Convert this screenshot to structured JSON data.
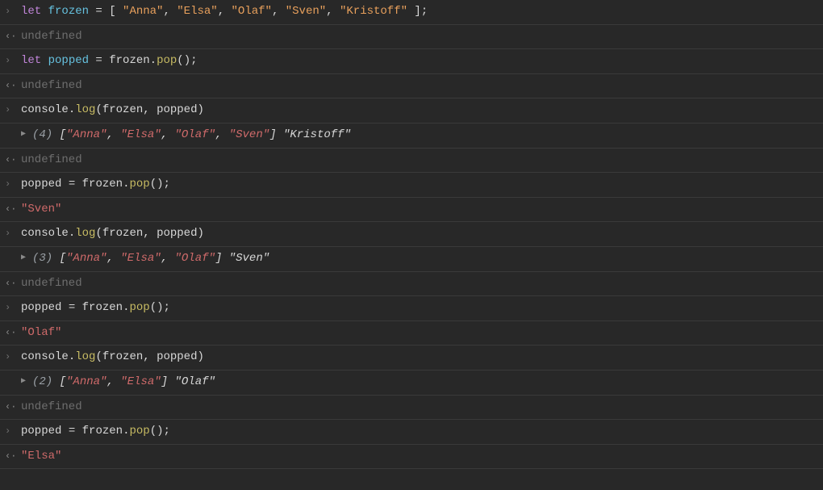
{
  "glyphs": {
    "input": "›",
    "output": "‹·",
    "expand": "▶"
  },
  "undefined": "undefined",
  "rows": [
    {
      "type": "input",
      "tokens": [
        {
          "t": "let ",
          "c": "kw"
        },
        {
          "t": "frozen",
          "c": "var1"
        },
        {
          "t": " = [ ",
          "c": "op"
        },
        {
          "t": "\"Anna\"",
          "c": "str"
        },
        {
          "t": ", ",
          "c": "pn"
        },
        {
          "t": "\"Elsa\"",
          "c": "str"
        },
        {
          "t": ", ",
          "c": "pn"
        },
        {
          "t": "\"Olaf\"",
          "c": "str"
        },
        {
          "t": ", ",
          "c": "pn"
        },
        {
          "t": "\"Sven\"",
          "c": "str"
        },
        {
          "t": ", ",
          "c": "pn"
        },
        {
          "t": "\"Kristoff\"",
          "c": "str"
        },
        {
          "t": " ];",
          "c": "pn"
        }
      ]
    },
    {
      "type": "output-undef"
    },
    {
      "type": "input",
      "tokens": [
        {
          "t": "let ",
          "c": "kw"
        },
        {
          "t": "popped",
          "c": "var1"
        },
        {
          "t": " = ",
          "c": "op"
        },
        {
          "t": "frozen",
          "c": "var"
        },
        {
          "t": ".",
          "c": "pn"
        },
        {
          "t": "pop",
          "c": "fn"
        },
        {
          "t": "();",
          "c": "pn"
        }
      ]
    },
    {
      "type": "output-undef"
    },
    {
      "type": "input",
      "tokens": [
        {
          "t": "console",
          "c": "var"
        },
        {
          "t": ".",
          "c": "pn"
        },
        {
          "t": "log",
          "c": "fn"
        },
        {
          "t": "(",
          "c": "pn"
        },
        {
          "t": "frozen",
          "c": "var"
        },
        {
          "t": ", ",
          "c": "pn"
        },
        {
          "t": "popped",
          "c": "var"
        },
        {
          "t": ")",
          "c": "pn"
        }
      ]
    },
    {
      "type": "log",
      "tokens": [
        {
          "t": "(4) ",
          "c": "cnt"
        },
        {
          "t": "[",
          "c": "wt"
        },
        {
          "t": "\"Anna\"",
          "c": "rs"
        },
        {
          "t": ", ",
          "c": "wt"
        },
        {
          "t": "\"Elsa\"",
          "c": "rs"
        },
        {
          "t": ", ",
          "c": "wt"
        },
        {
          "t": "\"Olaf\"",
          "c": "rs"
        },
        {
          "t": ", ",
          "c": "wt"
        },
        {
          "t": "\"Sven\"",
          "c": "rs"
        },
        {
          "t": "]",
          "c": "wt"
        },
        {
          "t": " ",
          "c": "wt"
        },
        {
          "t": "\"Kristoff\"",
          "c": "wt"
        }
      ]
    },
    {
      "type": "output-undef"
    },
    {
      "type": "input",
      "tokens": [
        {
          "t": "popped",
          "c": "var"
        },
        {
          "t": " = ",
          "c": "op"
        },
        {
          "t": "frozen",
          "c": "var"
        },
        {
          "t": ".",
          "c": "pn"
        },
        {
          "t": "pop",
          "c": "fn"
        },
        {
          "t": "();",
          "c": "pn"
        }
      ]
    },
    {
      "type": "output",
      "tokens": [
        {
          "t": "\"Sven\"",
          "c": "rs"
        }
      ]
    },
    {
      "type": "input",
      "tokens": [
        {
          "t": "console",
          "c": "var"
        },
        {
          "t": ".",
          "c": "pn"
        },
        {
          "t": "log",
          "c": "fn"
        },
        {
          "t": "(",
          "c": "pn"
        },
        {
          "t": "frozen",
          "c": "var"
        },
        {
          "t": ", ",
          "c": "pn"
        },
        {
          "t": "popped",
          "c": "var"
        },
        {
          "t": ")",
          "c": "pn"
        }
      ]
    },
    {
      "type": "log",
      "tokens": [
        {
          "t": "(3) ",
          "c": "cnt"
        },
        {
          "t": "[",
          "c": "wt"
        },
        {
          "t": "\"Anna\"",
          "c": "rs"
        },
        {
          "t": ", ",
          "c": "wt"
        },
        {
          "t": "\"Elsa\"",
          "c": "rs"
        },
        {
          "t": ", ",
          "c": "wt"
        },
        {
          "t": "\"Olaf\"",
          "c": "rs"
        },
        {
          "t": "]",
          "c": "wt"
        },
        {
          "t": " ",
          "c": "wt"
        },
        {
          "t": "\"Sven\"",
          "c": "wt"
        }
      ]
    },
    {
      "type": "output-undef"
    },
    {
      "type": "input",
      "tokens": [
        {
          "t": "popped",
          "c": "var"
        },
        {
          "t": " = ",
          "c": "op"
        },
        {
          "t": "frozen",
          "c": "var"
        },
        {
          "t": ".",
          "c": "pn"
        },
        {
          "t": "pop",
          "c": "fn"
        },
        {
          "t": "();",
          "c": "pn"
        }
      ]
    },
    {
      "type": "output",
      "tokens": [
        {
          "t": "\"Olaf\"",
          "c": "rs"
        }
      ]
    },
    {
      "type": "input",
      "tokens": [
        {
          "t": "console",
          "c": "var"
        },
        {
          "t": ".",
          "c": "pn"
        },
        {
          "t": "log",
          "c": "fn"
        },
        {
          "t": "(",
          "c": "pn"
        },
        {
          "t": "frozen",
          "c": "var"
        },
        {
          "t": ", ",
          "c": "pn"
        },
        {
          "t": "popped",
          "c": "var"
        },
        {
          "t": ")",
          "c": "pn"
        }
      ]
    },
    {
      "type": "log",
      "tokens": [
        {
          "t": "(2) ",
          "c": "cnt"
        },
        {
          "t": "[",
          "c": "wt"
        },
        {
          "t": "\"Anna\"",
          "c": "rs"
        },
        {
          "t": ", ",
          "c": "wt"
        },
        {
          "t": "\"Elsa\"",
          "c": "rs"
        },
        {
          "t": "]",
          "c": "wt"
        },
        {
          "t": " ",
          "c": "wt"
        },
        {
          "t": "\"Olaf\"",
          "c": "wt"
        }
      ]
    },
    {
      "type": "output-undef"
    },
    {
      "type": "input",
      "tokens": [
        {
          "t": "popped",
          "c": "var"
        },
        {
          "t": " = ",
          "c": "op"
        },
        {
          "t": "frozen",
          "c": "var"
        },
        {
          "t": ".",
          "c": "pn"
        },
        {
          "t": "pop",
          "c": "fn"
        },
        {
          "t": "();",
          "c": "pn"
        }
      ]
    },
    {
      "type": "output",
      "tokens": [
        {
          "t": "\"Elsa\"",
          "c": "rs"
        }
      ]
    }
  ]
}
